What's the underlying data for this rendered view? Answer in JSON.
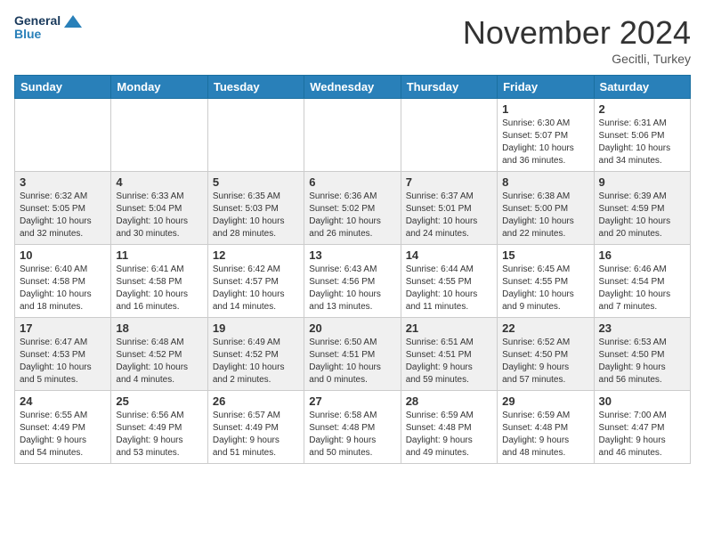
{
  "header": {
    "logo_line1": "General",
    "logo_line2": "Blue",
    "month": "November 2024",
    "location": "Gecitli, Turkey"
  },
  "weekdays": [
    "Sunday",
    "Monday",
    "Tuesday",
    "Wednesday",
    "Thursday",
    "Friday",
    "Saturday"
  ],
  "weeks": [
    [
      {
        "day": "",
        "info": ""
      },
      {
        "day": "",
        "info": ""
      },
      {
        "day": "",
        "info": ""
      },
      {
        "day": "",
        "info": ""
      },
      {
        "day": "",
        "info": ""
      },
      {
        "day": "1",
        "info": "Sunrise: 6:30 AM\nSunset: 5:07 PM\nDaylight: 10 hours\nand 36 minutes."
      },
      {
        "day": "2",
        "info": "Sunrise: 6:31 AM\nSunset: 5:06 PM\nDaylight: 10 hours\nand 34 minutes."
      }
    ],
    [
      {
        "day": "3",
        "info": "Sunrise: 6:32 AM\nSunset: 5:05 PM\nDaylight: 10 hours\nand 32 minutes."
      },
      {
        "day": "4",
        "info": "Sunrise: 6:33 AM\nSunset: 5:04 PM\nDaylight: 10 hours\nand 30 minutes."
      },
      {
        "day": "5",
        "info": "Sunrise: 6:35 AM\nSunset: 5:03 PM\nDaylight: 10 hours\nand 28 minutes."
      },
      {
        "day": "6",
        "info": "Sunrise: 6:36 AM\nSunset: 5:02 PM\nDaylight: 10 hours\nand 26 minutes."
      },
      {
        "day": "7",
        "info": "Sunrise: 6:37 AM\nSunset: 5:01 PM\nDaylight: 10 hours\nand 24 minutes."
      },
      {
        "day": "8",
        "info": "Sunrise: 6:38 AM\nSunset: 5:00 PM\nDaylight: 10 hours\nand 22 minutes."
      },
      {
        "day": "9",
        "info": "Sunrise: 6:39 AM\nSunset: 4:59 PM\nDaylight: 10 hours\nand 20 minutes."
      }
    ],
    [
      {
        "day": "10",
        "info": "Sunrise: 6:40 AM\nSunset: 4:58 PM\nDaylight: 10 hours\nand 18 minutes."
      },
      {
        "day": "11",
        "info": "Sunrise: 6:41 AM\nSunset: 4:58 PM\nDaylight: 10 hours\nand 16 minutes."
      },
      {
        "day": "12",
        "info": "Sunrise: 6:42 AM\nSunset: 4:57 PM\nDaylight: 10 hours\nand 14 minutes."
      },
      {
        "day": "13",
        "info": "Sunrise: 6:43 AM\nSunset: 4:56 PM\nDaylight: 10 hours\nand 13 minutes."
      },
      {
        "day": "14",
        "info": "Sunrise: 6:44 AM\nSunset: 4:55 PM\nDaylight: 10 hours\nand 11 minutes."
      },
      {
        "day": "15",
        "info": "Sunrise: 6:45 AM\nSunset: 4:55 PM\nDaylight: 10 hours\nand 9 minutes."
      },
      {
        "day": "16",
        "info": "Sunrise: 6:46 AM\nSunset: 4:54 PM\nDaylight: 10 hours\nand 7 minutes."
      }
    ],
    [
      {
        "day": "17",
        "info": "Sunrise: 6:47 AM\nSunset: 4:53 PM\nDaylight: 10 hours\nand 5 minutes."
      },
      {
        "day": "18",
        "info": "Sunrise: 6:48 AM\nSunset: 4:52 PM\nDaylight: 10 hours\nand 4 minutes."
      },
      {
        "day": "19",
        "info": "Sunrise: 6:49 AM\nSunset: 4:52 PM\nDaylight: 10 hours\nand 2 minutes."
      },
      {
        "day": "20",
        "info": "Sunrise: 6:50 AM\nSunset: 4:51 PM\nDaylight: 10 hours\nand 0 minutes."
      },
      {
        "day": "21",
        "info": "Sunrise: 6:51 AM\nSunset: 4:51 PM\nDaylight: 9 hours\nand 59 minutes."
      },
      {
        "day": "22",
        "info": "Sunrise: 6:52 AM\nSunset: 4:50 PM\nDaylight: 9 hours\nand 57 minutes."
      },
      {
        "day": "23",
        "info": "Sunrise: 6:53 AM\nSunset: 4:50 PM\nDaylight: 9 hours\nand 56 minutes."
      }
    ],
    [
      {
        "day": "24",
        "info": "Sunrise: 6:55 AM\nSunset: 4:49 PM\nDaylight: 9 hours\nand 54 minutes."
      },
      {
        "day": "25",
        "info": "Sunrise: 6:56 AM\nSunset: 4:49 PM\nDaylight: 9 hours\nand 53 minutes."
      },
      {
        "day": "26",
        "info": "Sunrise: 6:57 AM\nSunset: 4:49 PM\nDaylight: 9 hours\nand 51 minutes."
      },
      {
        "day": "27",
        "info": "Sunrise: 6:58 AM\nSunset: 4:48 PM\nDaylight: 9 hours\nand 50 minutes."
      },
      {
        "day": "28",
        "info": "Sunrise: 6:59 AM\nSunset: 4:48 PM\nDaylight: 9 hours\nand 49 minutes."
      },
      {
        "day": "29",
        "info": "Sunrise: 6:59 AM\nSunset: 4:48 PM\nDaylight: 9 hours\nand 48 minutes."
      },
      {
        "day": "30",
        "info": "Sunrise: 7:00 AM\nSunset: 4:47 PM\nDaylight: 9 hours\nand 46 minutes."
      }
    ]
  ]
}
